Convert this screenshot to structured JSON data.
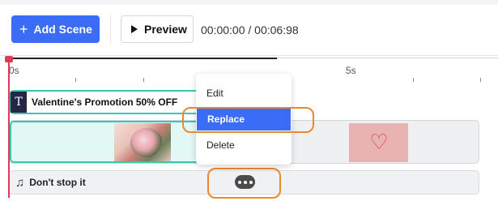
{
  "toolbar": {
    "add_scene_label": "Add Scene",
    "preview_label": "Preview",
    "time_display": "00:00:00 / 00:06:98"
  },
  "ruler": {
    "labels": [
      "0s",
      "5s"
    ]
  },
  "tracks": {
    "text_track_label": "Valentine's Promotion 50% OFF",
    "audio_track_label": "Don't stop it"
  },
  "context_menu": {
    "items": [
      "Edit",
      "Replace",
      "Delete"
    ],
    "active_item": "Replace"
  },
  "colors": {
    "accent": "#3b6cf6",
    "selection": "#39c9b2",
    "playhead": "#e03a57",
    "highlight_ring": "#e8892e"
  },
  "icons": {
    "add": "plus-icon",
    "preview": "play-icon",
    "text": "text-icon",
    "audio": "music-note-icon",
    "more": "more-options-icon"
  }
}
